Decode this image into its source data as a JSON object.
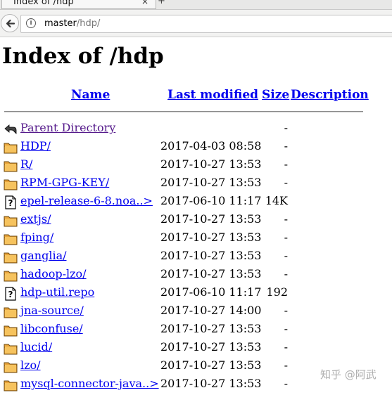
{
  "browser": {
    "tab_title": "Index of /hdp",
    "tab_close": "×",
    "new_tab": "+",
    "url_host": "master",
    "url_path": "/hdp/"
  },
  "page": {
    "title": "Index of /hdp",
    "columns": {
      "name": "Name",
      "last_modified": "Last modified",
      "size": "Size",
      "description": "Description"
    },
    "rows": [
      {
        "icon": "back-icon",
        "name": "Parent Directory",
        "date": "",
        "size": "-",
        "visited": true
      },
      {
        "icon": "folder-icon",
        "name": "HDP/",
        "date": "2017-04-03 08:58",
        "size": "-"
      },
      {
        "icon": "folder-icon",
        "name": "R/",
        "date": "2017-10-27 13:53",
        "size": "-"
      },
      {
        "icon": "folder-icon",
        "name": "RPM-GPG-KEY/",
        "date": "2017-10-27 13:53",
        "size": "-"
      },
      {
        "icon": "unknown-file-icon",
        "name": "epel-release-6-8.noa..>",
        "date": "2017-06-10 11:17",
        "size": "14K"
      },
      {
        "icon": "folder-icon",
        "name": "extjs/",
        "date": "2017-10-27 13:53",
        "size": "-"
      },
      {
        "icon": "folder-icon",
        "name": "fping/",
        "date": "2017-10-27 13:53",
        "size": "-"
      },
      {
        "icon": "folder-icon",
        "name": "ganglia/",
        "date": "2017-10-27 13:53",
        "size": "-"
      },
      {
        "icon": "folder-icon",
        "name": "hadoop-lzo/",
        "date": "2017-10-27 13:53",
        "size": "-"
      },
      {
        "icon": "unknown-file-icon",
        "name": "hdp-util.repo",
        "date": "2017-06-10 11:17",
        "size": "192"
      },
      {
        "icon": "folder-icon",
        "name": "jna-source/",
        "date": "2017-10-27 14:00",
        "size": "-"
      },
      {
        "icon": "folder-icon",
        "name": "libconfuse/",
        "date": "2017-10-27 13:53",
        "size": "-"
      },
      {
        "icon": "folder-icon",
        "name": "lucid/",
        "date": "2017-10-27 13:53",
        "size": "-"
      },
      {
        "icon": "folder-icon",
        "name": "lzo/",
        "date": "2017-10-27 13:53",
        "size": "-"
      },
      {
        "icon": "folder-icon",
        "name": "mysql-connector-java..>",
        "date": "2017-10-27 13:53",
        "size": "-"
      }
    ]
  },
  "watermark": "知乎 @阿武",
  "colors": {
    "link": "#0000ee",
    "visited": "#551a8b"
  }
}
